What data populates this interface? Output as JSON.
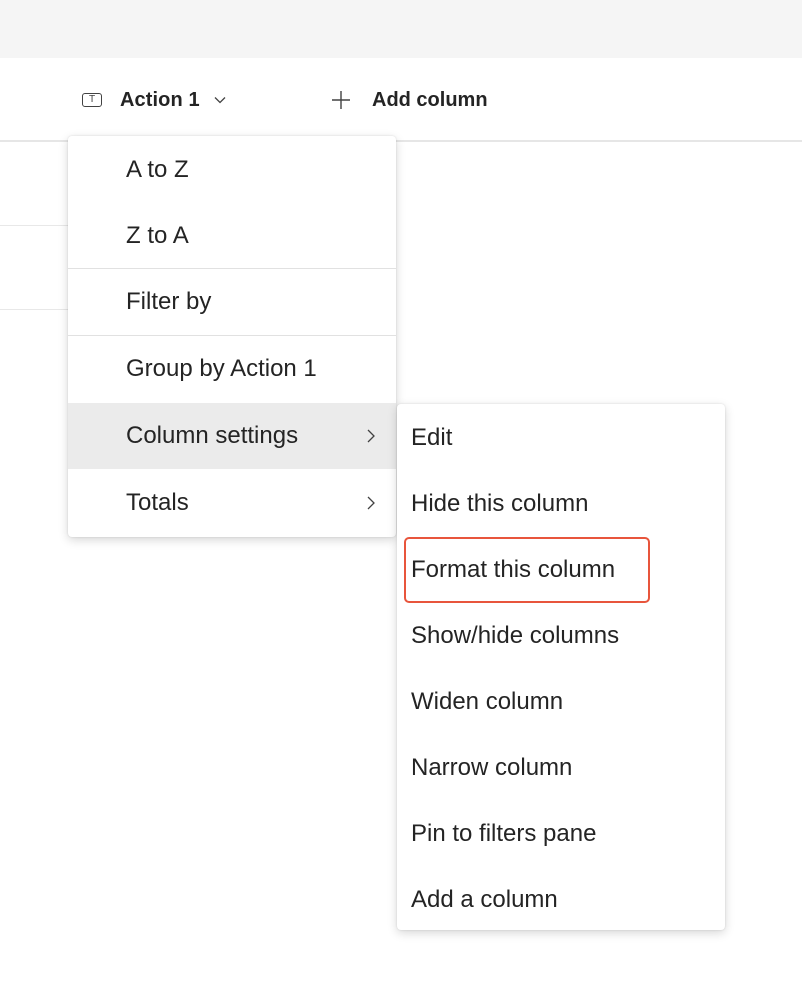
{
  "header": {
    "column_type_icon": "text-field-icon",
    "column_type_glyph": "T",
    "column_title": "Action 1",
    "add_column_label": "Add column"
  },
  "column_menu": {
    "items": [
      {
        "label": "A to Z"
      },
      {
        "label": "Z to A"
      },
      {
        "label": "Filter by"
      },
      {
        "label": "Group by Action 1"
      },
      {
        "label": "Column settings",
        "has_submenu": true,
        "active": true
      },
      {
        "label": "Totals",
        "has_submenu": true
      }
    ]
  },
  "column_settings_submenu": {
    "items": [
      {
        "label": "Edit"
      },
      {
        "label": "Hide this column"
      },
      {
        "label": "Format this column",
        "highlighted": true
      },
      {
        "label": "Show/hide columns"
      },
      {
        "label": "Widen column"
      },
      {
        "label": "Narrow column"
      },
      {
        "label": "Pin to filters pane"
      },
      {
        "label": "Add a column"
      }
    ]
  },
  "colors": {
    "highlight_border": "#e8553c",
    "active_item_bg": "#ebebeb",
    "top_strip_bg": "#f5f5f5"
  }
}
